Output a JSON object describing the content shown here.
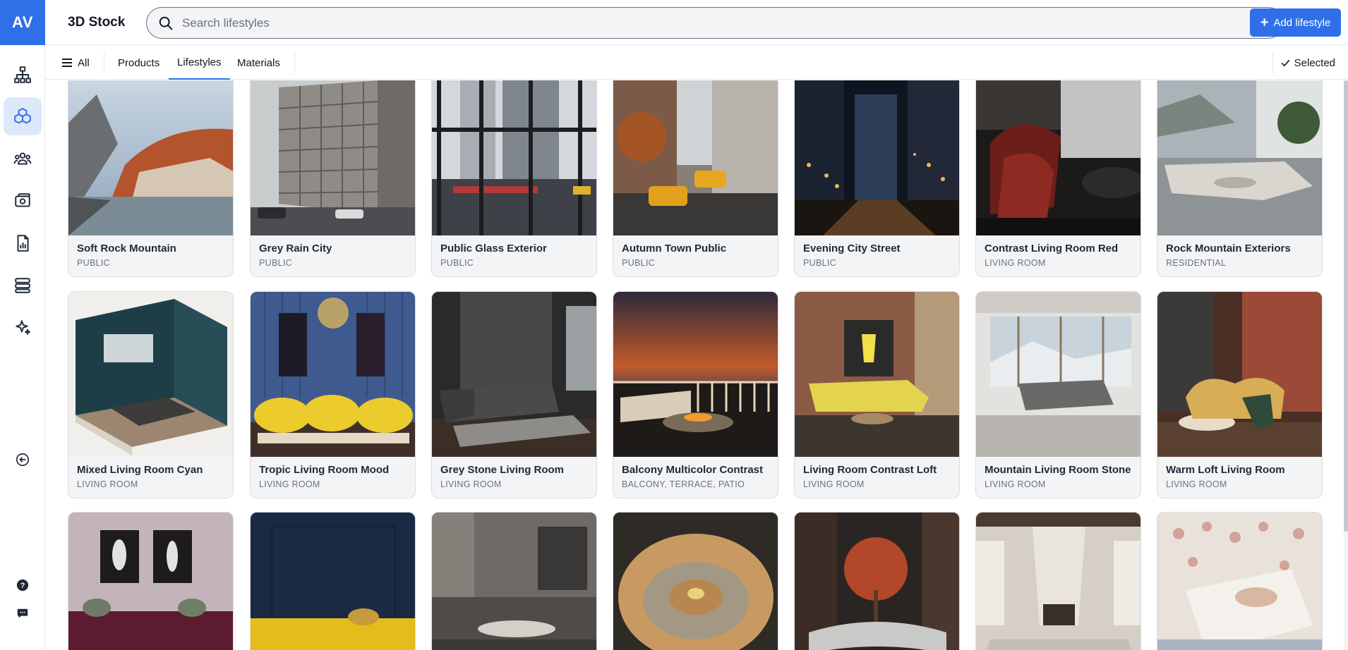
{
  "app": {
    "logo": "AV",
    "title": "3D Stock"
  },
  "search": {
    "placeholder": "Search lifestyles",
    "value": ""
  },
  "header": {
    "add_label": "Add lifestyle"
  },
  "tabs": {
    "all_label": "All",
    "items": [
      {
        "label": "Products",
        "active": false
      },
      {
        "label": "Lifestyles",
        "active": true
      },
      {
        "label": "Materials",
        "active": false
      }
    ],
    "selected_label": "Selected"
  },
  "rail": {
    "items": [
      {
        "icon": "hierarchy-icon",
        "active": false
      },
      {
        "icon": "cubes-icon",
        "active": true
      },
      {
        "icon": "users-icon",
        "active": false
      },
      {
        "icon": "camera-icon",
        "active": false
      },
      {
        "icon": "report-icon",
        "active": false
      },
      {
        "icon": "layers-icon",
        "active": false
      },
      {
        "icon": "sparkle-icon",
        "active": false
      }
    ],
    "collapse_icon": "collapse-left-icon",
    "help_icon": "help-icon",
    "chat_icon": "chat-icon"
  },
  "lifestyles": [
    {
      "name": "Soft Rock Mountain",
      "category": "PUBLIC"
    },
    {
      "name": "Grey Rain City",
      "category": "PUBLIC"
    },
    {
      "name": "Public Glass Exterior",
      "category": "PUBLIC"
    },
    {
      "name": "Autumn Town Public",
      "category": "PUBLIC"
    },
    {
      "name": "Evening City Street",
      "category": "PUBLIC"
    },
    {
      "name": "Contrast Living Room Red",
      "category": "LIVING ROOM"
    },
    {
      "name": "Rock Mountain Exteriors",
      "category": "RESIDENTIAL"
    },
    {
      "name": "Mixed Living Room Cyan",
      "category": "LIVING ROOM"
    },
    {
      "name": "Tropic Living Room Mood",
      "category": "LIVING ROOM"
    },
    {
      "name": "Grey Stone Living Room",
      "category": "LIVING ROOM"
    },
    {
      "name": "Balcony Multicolor Contrast",
      "category": "BALCONY, TERRACE, PATIO"
    },
    {
      "name": "Living Room Contrast Loft",
      "category": "LIVING ROOM"
    },
    {
      "name": "Mountain Living Room Stone",
      "category": "LIVING ROOM"
    },
    {
      "name": "Warm Loft Living Room",
      "category": "LIVING ROOM"
    }
  ],
  "colors": {
    "accent": "#2f6fe8",
    "rail_active_bg": "#dde8fb",
    "card_bg": "#f3f4f6"
  }
}
